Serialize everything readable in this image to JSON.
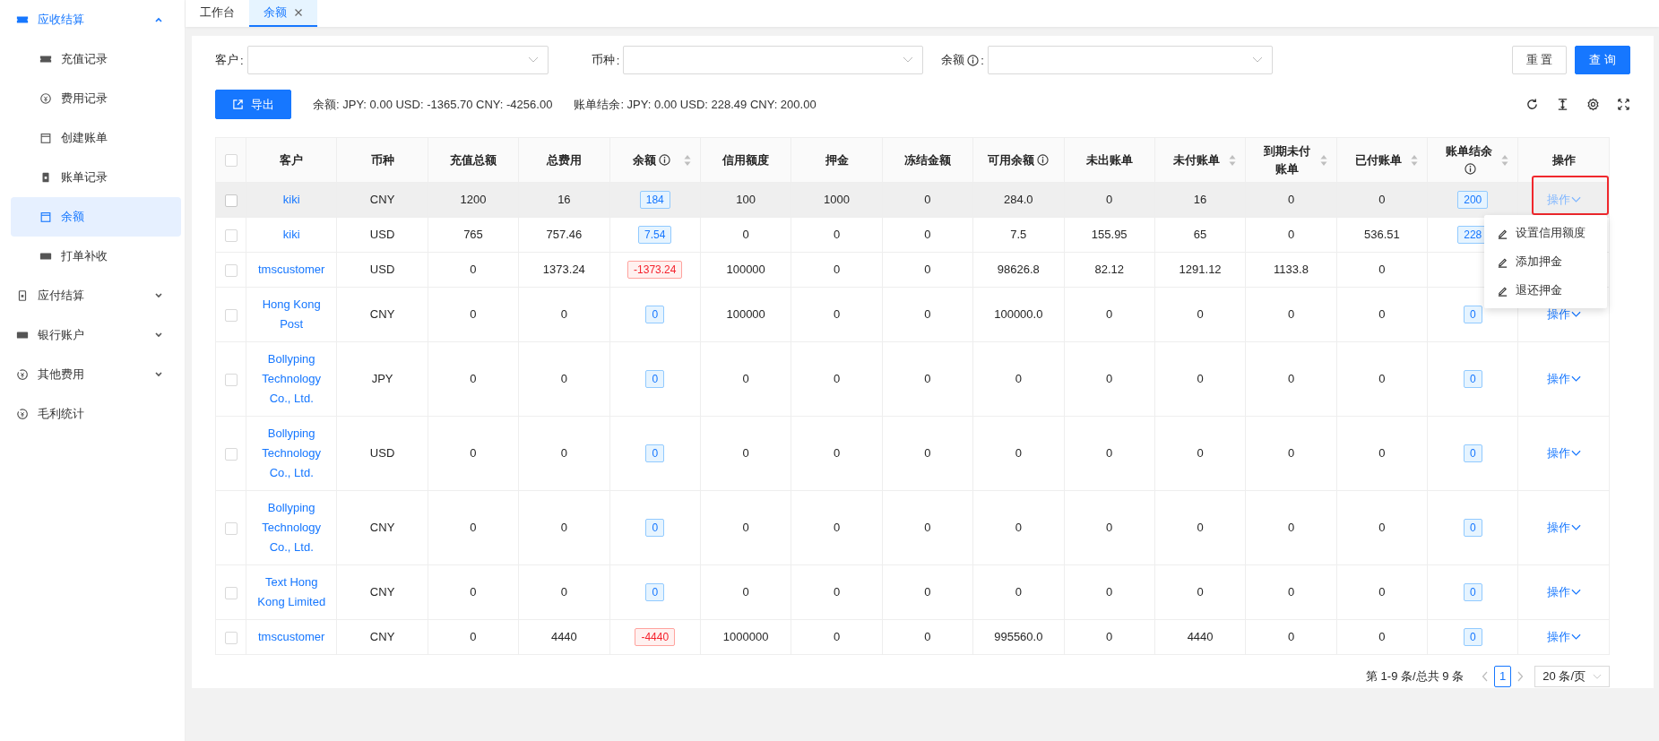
{
  "sidebar": {
    "items": [
      {
        "label": "应收结算",
        "selected": false,
        "expanded": true,
        "children": [
          {
            "label": "充值记录",
            "selected": false
          },
          {
            "label": "费用记录",
            "selected": false
          },
          {
            "label": "创建账单",
            "selected": false
          },
          {
            "label": "账单记录",
            "selected": false
          },
          {
            "label": "余额",
            "selected": true
          },
          {
            "label": "打单补收",
            "selected": false
          }
        ]
      },
      {
        "label": "应付结算",
        "selected": false,
        "expanded": false
      },
      {
        "label": "银行账户",
        "selected": false,
        "expanded": false
      },
      {
        "label": "其他费用",
        "selected": false,
        "expanded": false
      },
      {
        "label": "毛利统计",
        "selected": false
      }
    ]
  },
  "tabs": [
    {
      "label": "工作台",
      "selected": false,
      "closable": false
    },
    {
      "label": "余额",
      "selected": true,
      "closable": true
    }
  ],
  "filters": [
    {
      "label": "客户",
      "info": false,
      "colon": ":"
    },
    {
      "label": "币种",
      "info": false,
      "colon": ":"
    },
    {
      "label": "余额",
      "info": true,
      "colon": ":"
    }
  ],
  "buttons": [
    {
      "label": "重 置",
      "primary": false
    },
    {
      "label": "查 询",
      "primary": true
    }
  ],
  "export_button": "导出",
  "summary": [
    "余额: JPY: 0.00 USD: -1365.70 CNY: -4256.00",
    "账单结余: JPY: 0.00 USD: 228.49 CNY: 200.00"
  ],
  "table": {
    "select_all_checked": false,
    "columns": [
      {
        "label": "客户",
        "kind": "link",
        "info": false,
        "sortable": false
      },
      {
        "label": "币种",
        "kind": "text",
        "info": false,
        "sortable": false
      },
      {
        "label": "充值总额",
        "kind": "text",
        "info": false,
        "sortable": false
      },
      {
        "label": "总费用",
        "kind": "text",
        "info": false,
        "sortable": false
      },
      {
        "label": "余额",
        "kind": "badge",
        "info": true,
        "sortable": true
      },
      {
        "label": "信用额度",
        "kind": "text",
        "info": false,
        "sortable": false
      },
      {
        "label": "押金",
        "kind": "text",
        "info": false,
        "sortable": false
      },
      {
        "label": "冻结金额",
        "kind": "text",
        "info": false,
        "sortable": false
      },
      {
        "label": "可用余额",
        "kind": "text",
        "info": true,
        "sortable": false
      },
      {
        "label": "未出账单",
        "kind": "text",
        "info": false,
        "sortable": false
      },
      {
        "label": "未付账单",
        "kind": "text",
        "info": false,
        "sortable": true
      },
      {
        "label": "到期未付账单",
        "kind": "text",
        "info": false,
        "sortable": true
      },
      {
        "label": "已付账单",
        "kind": "text",
        "info": false,
        "sortable": true
      },
      {
        "label": "账单结余",
        "kind": "badge",
        "info": true,
        "sortable": true
      },
      {
        "label": "操作",
        "kind": "action",
        "info": false,
        "sortable": false
      }
    ],
    "rows": [
      {
        "checked": false,
        "hovered": true,
        "cells": [
          "kiki",
          "CNY",
          "1200",
          "16",
          {
            "text": "184",
            "negative": false
          },
          "100",
          "1000",
          "0",
          "284.0",
          "0",
          "16",
          "0",
          "0",
          {
            "text": "200",
            "negative": false
          },
          "操作"
        ]
      },
      {
        "checked": false,
        "hovered": false,
        "cells": [
          "kiki",
          "USD",
          "765",
          "757.46",
          {
            "text": "7.54",
            "negative": false
          },
          "0",
          "0",
          "0",
          "7.5",
          "155.95",
          "65",
          "0",
          "536.51",
          {
            "text": "228",
            "negative": false
          },
          null
        ]
      },
      {
        "checked": false,
        "hovered": false,
        "cells": [
          "tmscustomer",
          "USD",
          "0",
          "1373.24",
          {
            "text": "-1373.24",
            "negative": true
          },
          "100000",
          "0",
          "0",
          "98626.8",
          "82.12",
          "1291.12",
          "1133.8",
          "0",
          null,
          null
        ]
      },
      {
        "checked": false,
        "hovered": false,
        "cells": [
          "Hong Kong Post",
          "CNY",
          "0",
          "0",
          {
            "text": "0",
            "negative": false
          },
          "100000",
          "0",
          "0",
          "100000.0",
          "0",
          "0",
          "0",
          "0",
          {
            "text": "0",
            "negative": false
          },
          "操作"
        ]
      },
      {
        "checked": false,
        "hovered": false,
        "cells": [
          "Bollyping Technology Co., Ltd.",
          "JPY",
          "0",
          "0",
          {
            "text": "0",
            "negative": false
          },
          "0",
          "0",
          "0",
          "0",
          "0",
          "0",
          "0",
          "0",
          {
            "text": "0",
            "negative": false
          },
          "操作"
        ]
      },
      {
        "checked": false,
        "hovered": false,
        "cells": [
          "Bollyping Technology Co., Ltd.",
          "USD",
          "0",
          "0",
          {
            "text": "0",
            "negative": false
          },
          "0",
          "0",
          "0",
          "0",
          "0",
          "0",
          "0",
          "0",
          {
            "text": "0",
            "negative": false
          },
          "操作"
        ]
      },
      {
        "checked": false,
        "hovered": false,
        "cells": [
          "Bollyping Technology Co., Ltd.",
          "CNY",
          "0",
          "0",
          {
            "text": "0",
            "negative": false
          },
          "0",
          "0",
          "0",
          "0",
          "0",
          "0",
          "0",
          "0",
          {
            "text": "0",
            "negative": false
          },
          "操作"
        ]
      },
      {
        "checked": false,
        "hovered": false,
        "cells": [
          "Text Hong Kong Limited",
          "CNY",
          "0",
          "0",
          {
            "text": "0",
            "negative": false
          },
          "0",
          "0",
          "0",
          "0",
          "0",
          "0",
          "0",
          "0",
          {
            "text": "0",
            "negative": false
          },
          "操作"
        ]
      },
      {
        "checked": false,
        "hovered": false,
        "cells": [
          "tmscustomer",
          "CNY",
          "0",
          "4440",
          {
            "text": "-4440",
            "negative": true
          },
          "1000000",
          "0",
          "0",
          "995560.0",
          "0",
          "4440",
          "0",
          "0",
          {
            "text": "0",
            "negative": false
          },
          "操作"
        ]
      }
    ]
  },
  "menu": {
    "items": [
      "设置信用额度",
      "添加押金",
      "退还押金"
    ]
  },
  "pagination": {
    "summary": "第 1-9 条/总共 9 条",
    "pages": [
      {
        "label": "1",
        "selected": true
      }
    ],
    "page_size": "20 条/页"
  }
}
